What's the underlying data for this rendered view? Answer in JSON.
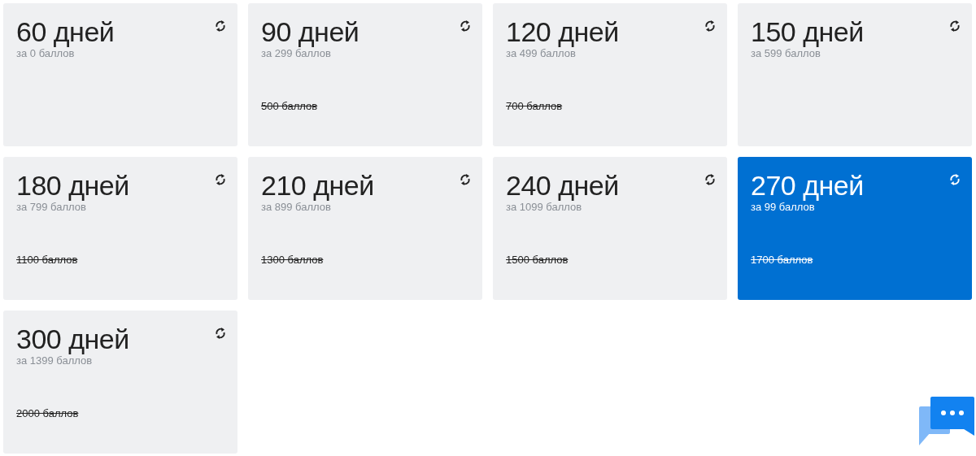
{
  "plans": [
    {
      "title": "60 дней",
      "price": "за 0 баллов",
      "selected": false
    },
    {
      "title": "90 дней",
      "price": "за 299 баллов",
      "old_price": "500 баллов",
      "selected": false
    },
    {
      "title": "120 дней",
      "price": "за 499 баллов",
      "old_price": "700 баллов",
      "selected": false
    },
    {
      "title": "150 дней",
      "price": "за 599 баллов",
      "selected": false
    },
    {
      "title": "180 дней",
      "price": "за 799 баллов",
      "old_price": "1100 баллов",
      "selected": false
    },
    {
      "title": "210 дней",
      "price": "за 899 баллов",
      "old_price": "1300 баллов",
      "selected": false
    },
    {
      "title": "240 дней",
      "price": "за 1099 баллов",
      "old_price": "1500 баллов",
      "selected": false
    },
    {
      "title": "270 дней",
      "price": "за 99 баллов",
      "old_price": "1700 баллов",
      "selected": true
    },
    {
      "title": "300 дней",
      "price": "за 1399 баллов",
      "old_price": "2000 баллов",
      "selected": false
    }
  ]
}
